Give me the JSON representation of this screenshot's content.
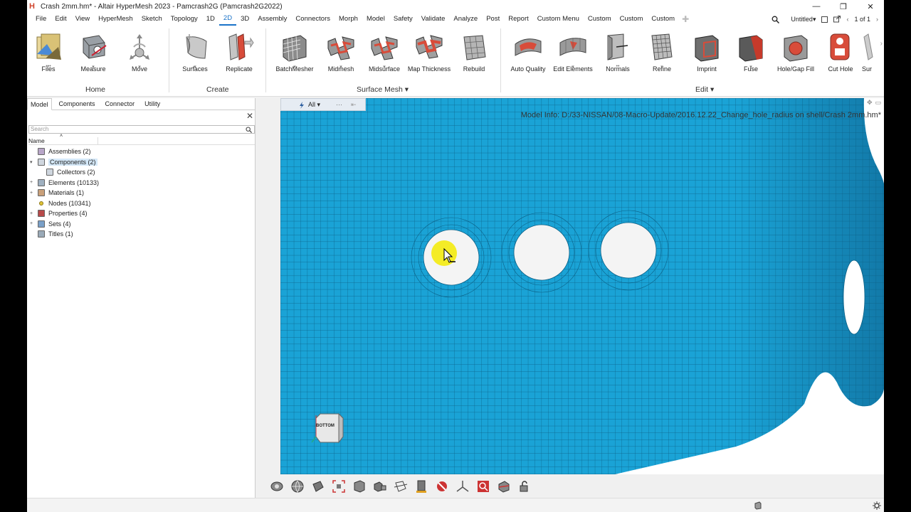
{
  "window": {
    "title": "Crash 2mm.hm* - Altair HyperMesh 2023 - Pamcrash2G (Pamcrash2G2022)",
    "app_icon": "H",
    "controls": [
      "—",
      "❐",
      "✕"
    ]
  },
  "menubar": {
    "items": [
      "File",
      "Edit",
      "View",
      "HyperMesh",
      "Sketch",
      "Topology",
      "1D",
      "2D",
      "3D",
      "Assembly",
      "Connectors",
      "Morph",
      "Model",
      "Safety",
      "Validate",
      "Analyze",
      "Post",
      "Report",
      "Custom Menu",
      "Custom",
      "Custom",
      "Custom"
    ],
    "active": "2D",
    "add_icon": "plus-icon",
    "right": {
      "search_icon": "search-icon",
      "layout": "Untitled▾",
      "page": "1 of 1"
    }
  },
  "ribbon": {
    "tools": [
      {
        "label": "Files",
        "icon": "files-icon"
      },
      {
        "label": "Measure",
        "icon": "measure-icon"
      },
      {
        "label": "Move",
        "icon": "move-icon"
      },
      {
        "label": "Surfaces",
        "icon": "surfaces-icon"
      },
      {
        "label": "Replicate",
        "icon": "replicate-icon"
      },
      {
        "label": "BatchMesher",
        "icon": "batchmesher-icon"
      },
      {
        "label": "Midmesh",
        "icon": "midmesh-icon"
      },
      {
        "label": "Midsurface",
        "icon": "midsurface-icon"
      },
      {
        "label": "Map Thickness",
        "icon": "map-thickness-icon"
      },
      {
        "label": "Rebuild",
        "icon": "rebuild-icon"
      },
      {
        "label": "Auto Quality",
        "icon": "auto-quality-icon"
      },
      {
        "label": "Edit Elements",
        "icon": "edit-elements-icon"
      },
      {
        "label": "Normals",
        "icon": "normals-icon"
      },
      {
        "label": "Refine",
        "icon": "refine-icon"
      },
      {
        "label": "Imprint",
        "icon": "imprint-icon"
      },
      {
        "label": "Fuse",
        "icon": "fuse-icon"
      },
      {
        "label": "Hole/Gap Fill",
        "icon": "hole-gap-fill-icon"
      },
      {
        "label": "Cut Hole",
        "icon": "cut-hole-icon"
      },
      {
        "label": "Sur",
        "icon": "surface-icon"
      }
    ],
    "groups": [
      "Home",
      "Create",
      "Surface Mesh ▾",
      "Edit ▾"
    ]
  },
  "panel": {
    "tabs": [
      "Model",
      "Components",
      "Connector",
      "Utility"
    ],
    "active_tab": "Model",
    "search_placeholder": "Search",
    "column_name": "Name",
    "tree": [
      {
        "label": "Assemblies  (2)",
        "expander": "",
        "level": 0
      },
      {
        "label": "Components  (2)",
        "expander": "▾",
        "level": 0,
        "selected": true
      },
      {
        "label": "Collectors  (2)",
        "expander": "",
        "level": 1
      },
      {
        "label": "Elements  (10133)",
        "expander": "+",
        "level": 0
      },
      {
        "label": "Materials  (1)",
        "expander": "+",
        "level": 0
      },
      {
        "label": "Nodes  (10341)",
        "expander": "",
        "level": 0
      },
      {
        "label": "Properties  (4)",
        "expander": "+",
        "level": 0
      },
      {
        "label": "Sets  (4)",
        "expander": "+",
        "level": 0
      },
      {
        "label": "Titles  (1)",
        "expander": "",
        "level": 0
      }
    ]
  },
  "viewport": {
    "filter": "All",
    "filter_icon": "lightning-icon",
    "model_info": "Model Info: D:/33-NISSAN/08-Macro-Update/2016.12.22_Change_hole_radius on shell/Crash 2mm.hm*",
    "view_cube_label": "BOTTOM",
    "mesh_color": "#1aa3d6",
    "mesh_line_color": "#0b5f85"
  }
}
